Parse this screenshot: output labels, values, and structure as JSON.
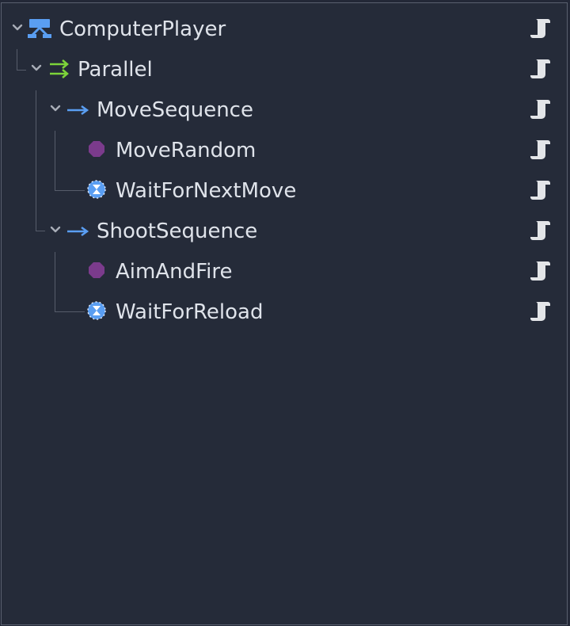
{
  "colors": {
    "background": "#252b39",
    "border": "#59606f",
    "text": "#dfe3ea",
    "guide": "#565c6a",
    "chevron": "#a8adb7",
    "tree_icon": "#5a9ef2",
    "parallel_icon": "#7dd33a",
    "sequence_icon": "#5a9ef2",
    "action_icon": "#7b3b8c",
    "wait_icon": "#5a9ef2",
    "script_icon": "#e3e5e8"
  },
  "tree": {
    "nodes": [
      {
        "label": "ComputerPlayer",
        "icon": "behavior-tree-icon",
        "has_chevron": true,
        "depth": 0
      },
      {
        "label": "Parallel",
        "icon": "parallel-icon",
        "has_chevron": true,
        "depth": 1
      },
      {
        "label": "MoveSequence",
        "icon": "sequence-arrow-icon",
        "has_chevron": true,
        "depth": 2
      },
      {
        "label": "MoveRandom",
        "icon": "action-octagon-icon",
        "has_chevron": false,
        "depth": 3
      },
      {
        "label": "WaitForNextMove",
        "icon": "wait-hourglass-icon",
        "has_chevron": false,
        "depth": 3
      },
      {
        "label": "ShootSequence",
        "icon": "sequence-arrow-icon",
        "has_chevron": true,
        "depth": 2
      },
      {
        "label": "AimAndFire",
        "icon": "action-octagon-icon",
        "has_chevron": false,
        "depth": 3
      },
      {
        "label": "WaitForReload",
        "icon": "wait-hourglass-icon",
        "has_chevron": false,
        "depth": 3
      }
    ]
  }
}
